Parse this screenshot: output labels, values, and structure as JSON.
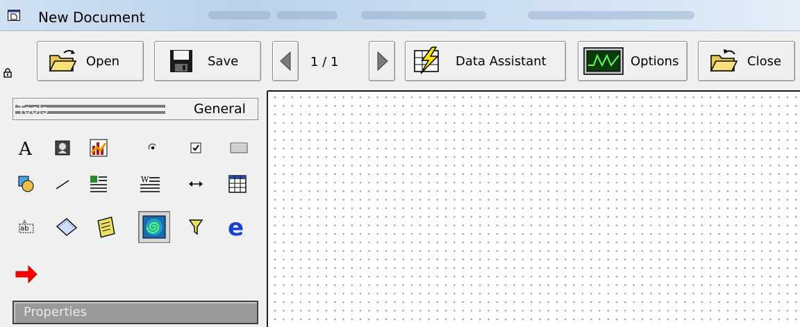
{
  "window": {
    "title": "New Document"
  },
  "toolbar": {
    "open_label": "Open",
    "save_label": "Save",
    "page_indicator": "1 / 1",
    "data_assistant_label": "Data Assistant",
    "options_label": "Options",
    "close_label": "Close"
  },
  "tools_panel": {
    "header_label": "Tools",
    "tab_label": "General",
    "tools": [
      "text-tool-icon",
      "image-tool-icon",
      "chart-tool-icon",
      "radio-button-tool-icon",
      "checkbox-tool-icon",
      "button-tool-icon",
      "shape-tool-icon",
      "line-tool-icon",
      "table-text-tool-icon",
      "word-tool-icon",
      "dimension-tool-icon",
      "grid-tool-icon",
      "field-tool-icon",
      "eraser-tool-icon",
      "scroll-tool-icon",
      "swirl-tool-icon",
      "filter-tool-icon",
      "web-browser-tool-icon",
      "arrow-tool-icon"
    ],
    "selected_tool": "swirl-tool-icon"
  },
  "properties_panel": {
    "header_label": "Properties"
  },
  "colors": {
    "titlebar": "#c9dbef",
    "toolbar_bg": "#f0f0f0",
    "arrow_red": "#ff0000",
    "ie_blue": "#1a40d0"
  }
}
